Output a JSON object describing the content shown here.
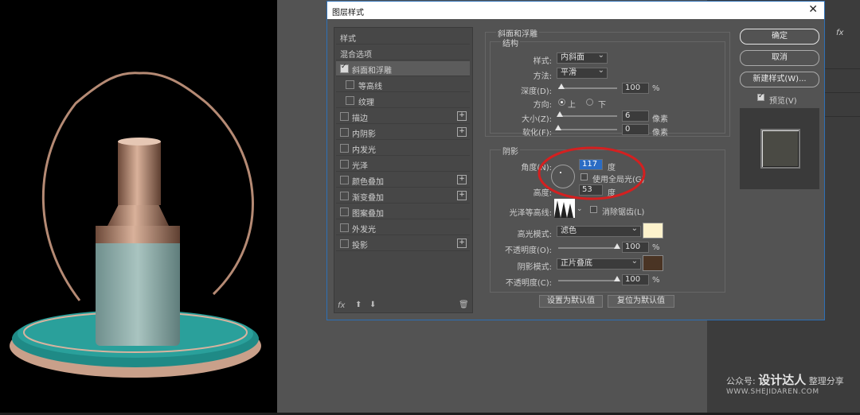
{
  "dialog": {
    "title": "图层样式",
    "close_icon": "close-icon"
  },
  "style_list": {
    "header": "样式",
    "blend": "混合选项",
    "items": [
      {
        "label": "斜面和浮雕",
        "checked": true,
        "selected": true
      },
      {
        "label": "等高线",
        "checked": false,
        "child": true
      },
      {
        "label": "纹理",
        "checked": false,
        "child": true
      },
      {
        "label": "描边",
        "checked": false,
        "plus": true
      },
      {
        "label": "内阴影",
        "checked": false,
        "plus": true
      },
      {
        "label": "内发光",
        "checked": false
      },
      {
        "label": "光泽",
        "checked": false
      },
      {
        "label": "颜色叠加",
        "checked": false,
        "plus": true
      },
      {
        "label": "渐变叠加",
        "checked": false,
        "plus": true
      },
      {
        "label": "图案叠加",
        "checked": false
      },
      {
        "label": "外发光",
        "checked": false
      },
      {
        "label": "投影",
        "checked": false,
        "plus": true
      }
    ],
    "footer_fx": "fx"
  },
  "bevel": {
    "group_title": "斜面和浮雕",
    "structure_title": "结构",
    "style_label": "样式:",
    "style_value": "内斜面",
    "technique_label": "方法:",
    "technique_value": "平滑",
    "depth_label": "深度(D):",
    "depth_value": "100",
    "depth_unit": "%",
    "direction_label": "方向:",
    "dir_up": "上",
    "dir_down": "下",
    "size_label": "大小(Z):",
    "size_value": "6",
    "size_unit": "像素",
    "soften_label": "软化(F):",
    "soften_value": "0",
    "soften_unit": "像素"
  },
  "shading": {
    "group_title": "阴影",
    "angle_label": "角度(N):",
    "angle_value": "117",
    "angle_unit": "度",
    "global_light_label": "使用全局光(G)",
    "altitude_label": "高度:",
    "altitude_value": "53",
    "altitude_unit": "度",
    "gloss_contour_label": "光泽等高线:",
    "anti_alias_label": "消除锯齿(L)",
    "highlight_mode_label": "高光模式:",
    "highlight_mode_value": "滤色",
    "highlight_color": "#fdf2cc",
    "highlight_opacity_label": "不透明度(O):",
    "highlight_opacity_value": "100",
    "shadow_mode_label": "阴影模式:",
    "shadow_mode_value": "正片叠底",
    "shadow_color": "#4a3424",
    "shadow_opacity_label": "不透明度(C):",
    "shadow_opacity_value": "100",
    "percent": "%"
  },
  "bottom_buttons": {
    "make_default": "设置为默认值",
    "reset_default": "复位为默认值"
  },
  "right_buttons": {
    "ok": "确定",
    "cancel": "取消",
    "new_style": "新建样式(W)...",
    "preview_label": "预览(V)"
  },
  "side_panel": {
    "fx_label": "fx"
  },
  "watermark": {
    "prefix": "公众号:",
    "brand": "设计达人",
    "suffix": "整理分享",
    "url": "WWW.SHEJIDAREN.COM"
  },
  "colors": {
    "annotation_red": "#d42020",
    "accent_teal": "#1f8a86"
  }
}
